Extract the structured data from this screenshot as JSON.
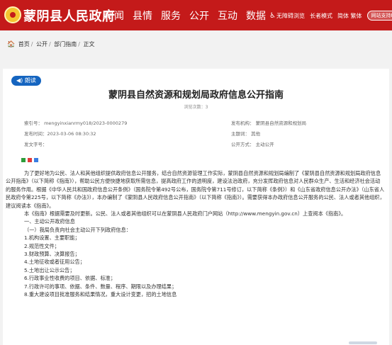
{
  "header": {
    "site_name": "蒙阴县人民政府",
    "nav": [
      "新闻",
      "县情",
      "服务",
      "公开",
      "互动",
      "数据"
    ],
    "tools": {
      "accessibility": "无障碍浏览",
      "elder_mode": "长者模式",
      "lang": "简体 繁体",
      "mobile": "网站支持IPv6"
    },
    "brand_color": "#c41a1a"
  },
  "breadcrumb": {
    "items": [
      "首页",
      "公开",
      "部门指南",
      "正文"
    ]
  },
  "article": {
    "read_label": "朗读",
    "title": "蒙阴县自然资源和规划局政府信息公开指南",
    "views": "浏览次数：3",
    "meta": {
      "index_no": "索引号：   mengyinxianrmy018/2023-0000279",
      "publish_date": "发布时间：2023-03-06 08:30:32",
      "doc_no": "发文字号：",
      "publisher": "发布机构：   蒙阴县自然资源和规划局",
      "subject": "主题词：      其他",
      "disclosure": "公开方式：   主动公开"
    },
    "paragraphs": [
      "为了更好地为公民、法人和其他组织提供政府信息公开服务，结合自然资源管理工作实际，蒙阴县自然资源和规划局编制了《蒙阴县自然资源和规划局政府信息公开指南》（以下简称《指南》），帮助公民方便快捷地获取所需信息，提高政府工作的透明度，建设法治政府，充分发挥政府信息对人民群众生产、生活和经济社会活动的服务作用。根据《中华人民共和国政府信息公开条例》（国务院令第492号公布，国务院令第711号修订，以下简称《条例》）和《山东省政府信息公开办法》（山东省人民政府令第225号，以下简称《办法》），本办编制了《蒙阴县人民政府信息公开指南》（以下简称《指南》）。需要获得本办政府信息公开服务的公民、法人或者其他组织，建议阅读本《指南》。",
      "本《指南》根据需要及时更新。公民、法人或者其他组织可以在蒙阴县人民政府门户网站（http://www.mengyin.gov.cn）上查阅本《指南》。",
      "一、主动公开政府信息",
      "（一）我局负责向社会主动公开下列政府信息：",
      "1.机构设置、主要职能；",
      "2.规范性文件；",
      "3.财政预算、决算报告；",
      "4.土地征收或者征用公告；",
      "5.土地出让公示公告；",
      "6.行政事业性收费的项目、依据、标准；",
      "7.行政许可的事项、依据、条件、数量、程序、期限以及办理结果；",
      "8.重大建设项目批准服务和结果情况，重大设计变更，招的土地信息"
    ]
  }
}
